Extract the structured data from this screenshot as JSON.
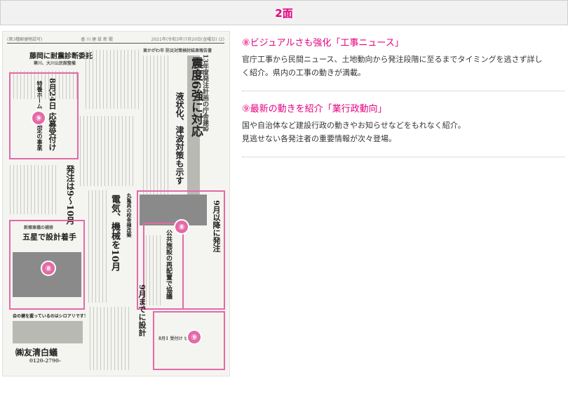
{
  "header": {
    "title": "2面"
  },
  "newspaper": {
    "masthead": {
      "left": "(第3種郵便物認可)",
      "center": "香 川 建 設 新 聞",
      "right": "2021年(令和3年)7月20日(金曜日) (2)"
    },
    "headlines": {
      "h1": "藤岡に耐震診断委託",
      "h1_sub": "寒川、大川公民館整備",
      "h2": "震度6強に対応",
      "h2_sub": "液状化、津波対策も示す",
      "h2_top": "13年度発注計画の庁舎建設",
      "h3": "8月24日 応募受付け",
      "h3_sub": "特養ホーム 公募選定の事業者",
      "h4": "発注は9〜10月",
      "h5": "五星で設計着手",
      "h5_sub": "新郷東橋の補修",
      "h6": "電気、機械を10月",
      "h6_sub": "丸亀高の校舎棟改築",
      "h7": "9月以降に発注",
      "h8": "9月までに設計",
      "h9": "公共施設の再配置で協議",
      "h10": "東かがわ市 防災対策検討結果報告書",
      "ad_top": "会の健を握っているのはシロアリです!",
      "ad_company": "㈱友清白蟻",
      "ad_phone": "0120-2790-"
    },
    "badges": {
      "b1": "⑨",
      "b2": "⑧",
      "b3": "⑧",
      "b4": "⑨"
    },
    "badge_note": "8月1 受付け ビス サ"
  },
  "features": [
    {
      "title": "⑧ビジュアルさも強化「工事ニュース」",
      "lines": [
        "官庁工事から民間ニュース、土地動向から発注段階に至るまでタイミングを逃さず詳し",
        "く紹介。県内の工事の動きが満載。"
      ]
    },
    {
      "title": "⑨最新の動きを紹介「業行政動向」",
      "lines": [
        "国や自治体など建設行政の動きやお知らせなどをもれなく紹介。",
        "見逃せない各発注者の重要情報が次々登場。"
      ]
    }
  ],
  "colors": {
    "accent": "#e4007f",
    "box": "#e36aa6"
  }
}
